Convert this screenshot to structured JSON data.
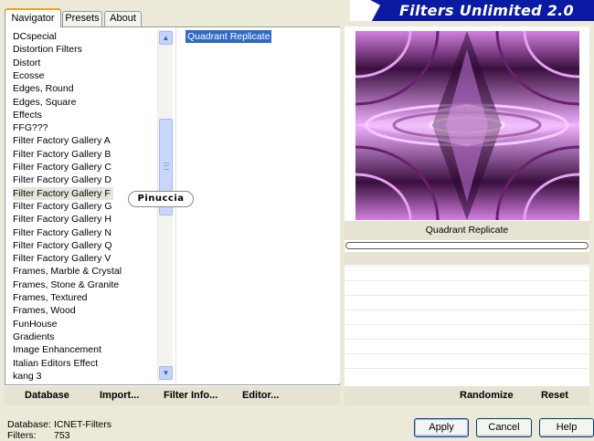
{
  "tabs": [
    {
      "label": "Navigator",
      "active": true
    },
    {
      "label": "Presets",
      "active": false
    },
    {
      "label": "About",
      "active": false
    }
  ],
  "banner": {
    "title": "Filters Unlimited 2.0"
  },
  "categories": [
    "DCspecial",
    "Distortion Filters",
    "Distort",
    "Ecosse",
    "Edges, Round",
    "Edges, Square",
    "Effects",
    "FFG???",
    "Filter Factory Gallery A",
    "Filter Factory Gallery B",
    "Filter Factory Gallery C",
    "Filter Factory Gallery D",
    "Filter Factory Gallery F",
    "Filter Factory Gallery G",
    "Filter Factory Gallery H",
    "Filter Factory Gallery N",
    "Filter Factory Gallery Q",
    "Filter Factory Gallery V",
    "Frames, Marble & Crystal",
    "Frames, Stone & Granite",
    "Frames, Textured",
    "Frames, Wood",
    "FunHouse",
    "Gradients",
    "Image Enhancement",
    "Italian Editors Effect",
    "kang 3"
  ],
  "selected_category": "Filter Factory Gallery F",
  "filters": [
    "Quadrant Replicate"
  ],
  "watermark": "Pinuccia",
  "preview": {
    "filter_name": "Quadrant Replicate"
  },
  "toolbar": {
    "database_label": "Database",
    "import_label": "Import...",
    "filter_info_label": "Filter Info...",
    "editor_label": "Editor...",
    "randomize_label": "Randomize",
    "reset_label": "Reset"
  },
  "status": {
    "database_label": "Database:",
    "database_value": "ICNET-Filters",
    "filters_label": "Filters:",
    "filters_value": "753"
  },
  "buttons": {
    "apply": "Apply",
    "cancel": "Cancel",
    "help": "Help"
  },
  "colors": {
    "banner": "#0a1aa2",
    "selection": "#316ac5",
    "tab_accent": "#f1a60f"
  }
}
